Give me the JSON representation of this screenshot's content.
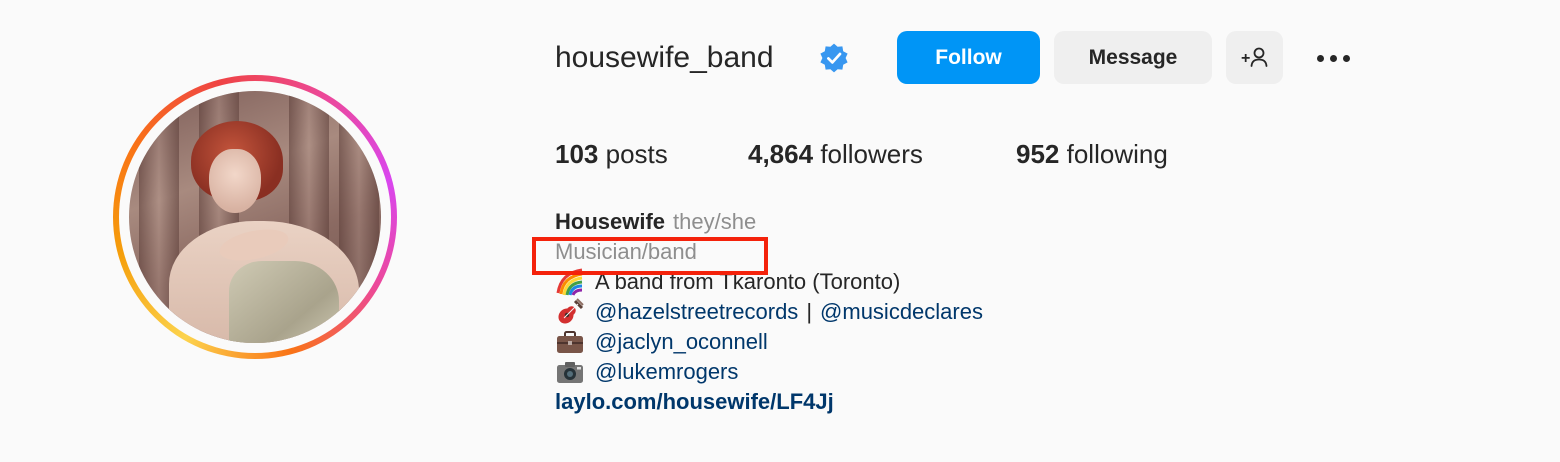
{
  "profile": {
    "username": "housewife_band",
    "verified": true,
    "follow_label": "Follow",
    "message_label": "Message",
    "add_user_glyph": "+",
    "stats": {
      "posts_count": "103",
      "posts_label": "posts",
      "followers_count": "4,864",
      "followers_label": "followers",
      "following_count": "952",
      "following_label": "following"
    },
    "bio": {
      "name": "Housewife",
      "pronouns": "they/she",
      "category": "Musician/band",
      "lines": [
        {
          "icon": "rainbow-icon",
          "text": "A band from Tkaronto (Toronto)"
        },
        {
          "icon": "guitar-icon",
          "link1": "@hazelstreetrecords",
          "separator": "|",
          "link2": "@musicdeclares"
        },
        {
          "icon": "briefcase-icon",
          "link1": "@jaclyn_oconnell"
        },
        {
          "icon": "camera-icon",
          "link1": "@lukemrogers"
        }
      ],
      "website": "laylo.com/housewife/LF4Jj"
    }
  },
  "colors": {
    "background": "#fafafa",
    "follow_button": "#0095f6",
    "secondary_button": "#efefef",
    "link": "#00376b",
    "muted_text": "#8e8e8e",
    "highlight_border": "#f4220b",
    "verified_badge": "#3897f0"
  }
}
